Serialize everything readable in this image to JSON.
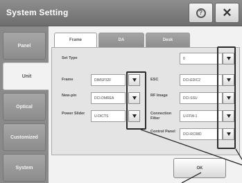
{
  "window": {
    "title": "System Setting",
    "help_icon": "help-icon",
    "help_glyph": "?",
    "close_icon": "close-icon",
    "close_glyph": "✕"
  },
  "sidebar": {
    "items": [
      {
        "label": "Panel",
        "active": false
      },
      {
        "label": "Unit",
        "active": true
      },
      {
        "label": "Optical",
        "active": false
      },
      {
        "label": "Customized",
        "active": false
      },
      {
        "label": "System",
        "active": false
      }
    ]
  },
  "tabs": [
    {
      "label": "Frame",
      "active": true
    },
    {
      "label": "DA",
      "active": false
    },
    {
      "label": "Desk",
      "active": false
    }
  ],
  "settings": {
    "set_type": {
      "label": "Set Type",
      "value": "0"
    },
    "frame": {
      "label": "Frame",
      "value": "DIMSP32F"
    },
    "new_pin": {
      "label": "New-pin",
      "value": "DCI-DMREA"
    },
    "power_slider": {
      "label": "Power Slider",
      "value": "U-DICTS"
    },
    "esc": {
      "label": "ESC",
      "value": "DCI-EDIC2"
    },
    "rf_image": {
      "label": "RF Image",
      "value": "DCI-SSU"
    },
    "connection_filter": {
      "label": "Connection Filter",
      "value": "U-FFW-1"
    },
    "control_panel": {
      "label": "Control Panel",
      "value": "DCI-RC08D"
    }
  },
  "ok_label": "OK",
  "dropdown_icon": "chevron-down-icon",
  "colors": {
    "title_bar": "#7a7a7a",
    "sidebar": "#8a8a8a",
    "active_tab": "#ffffff",
    "panel": "#e4e4e4",
    "callout": "#2a2a2a"
  }
}
